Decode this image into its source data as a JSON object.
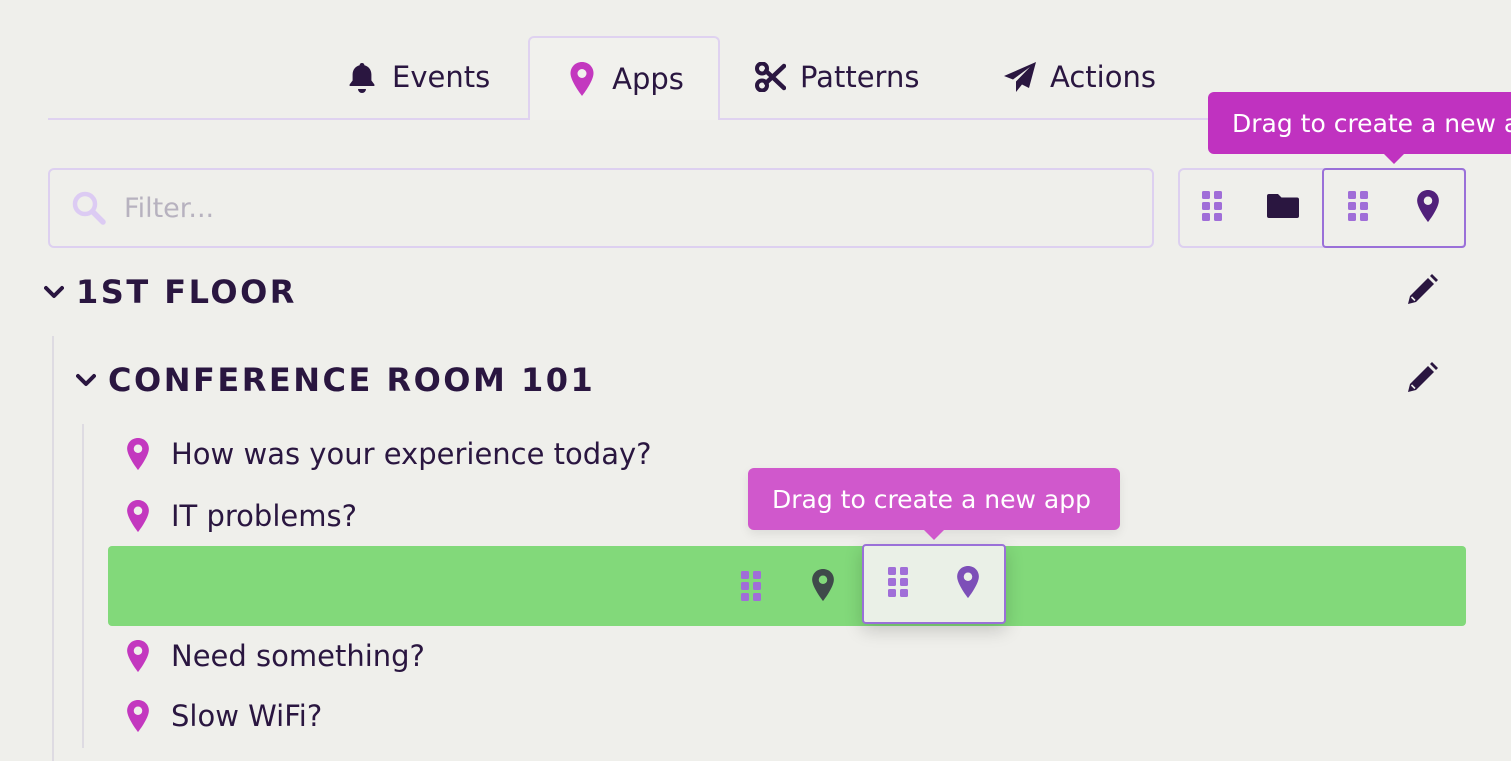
{
  "tabs": [
    {
      "label": "Events",
      "icon": "bell-icon"
    },
    {
      "label": "Apps",
      "icon": "map-pin-icon",
      "active": true
    },
    {
      "label": "Patterns",
      "icon": "scissors-icon"
    },
    {
      "label": "Actions",
      "icon": "paper-plane-icon"
    }
  ],
  "filter": {
    "placeholder": "Filter..."
  },
  "toolbar": {
    "tooltip": "Drag to create a new app",
    "folder_group": [
      "drag-handle-icon",
      "folder-icon"
    ],
    "app_group": [
      "drag-handle-icon",
      "map-pin-icon"
    ]
  },
  "tree": {
    "floor": {
      "title": "1ST FLOOR"
    },
    "room": {
      "title": "CONFERENCE ROOM 101"
    },
    "items": [
      {
        "label": "How was your experience today?"
      },
      {
        "label": "IT problems?"
      },
      {
        "label": "Need something?"
      },
      {
        "label": "Slow WiFi?"
      }
    ]
  },
  "drag": {
    "tooltip": "Drag to create a new app"
  },
  "colors": {
    "accent": "#c032c0",
    "pin": "#c338bf",
    "dark": "#2a1640",
    "drop_zone": "#82d97a",
    "handle": "#a06ed8",
    "border": "#ddd0f0"
  }
}
